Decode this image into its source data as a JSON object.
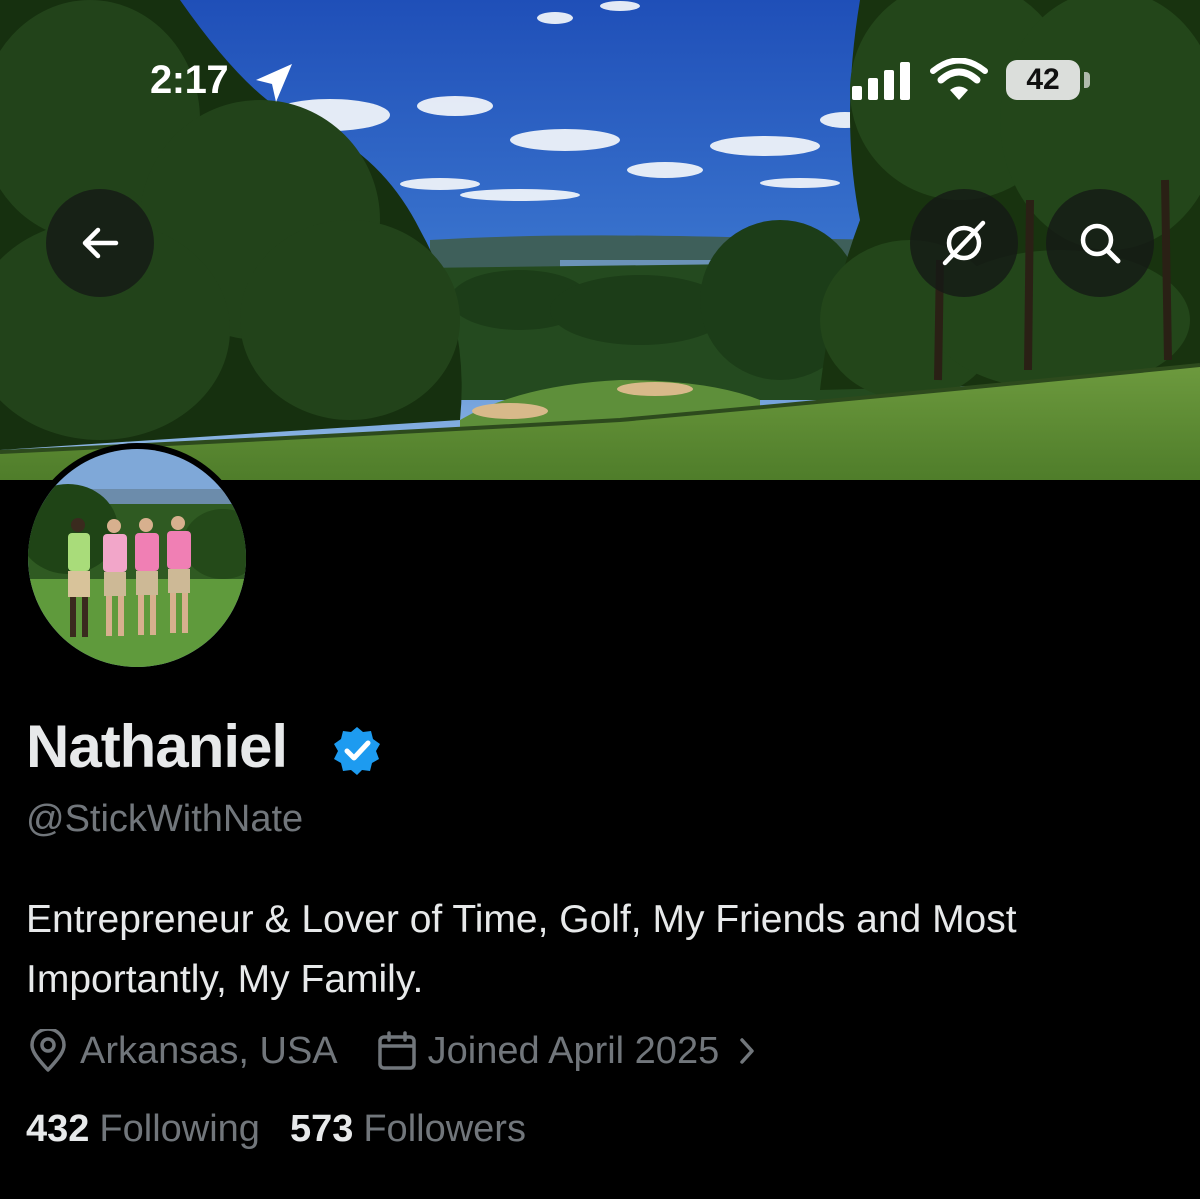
{
  "status_bar": {
    "time": "2:17",
    "battery": "42"
  },
  "header": {
    "back_icon": "arrow-left-icon",
    "grok_icon": "grok-slash-icon",
    "search_icon": "search-icon"
  },
  "profile": {
    "display_name": "Nathaniel",
    "handle": "@StickWithNate",
    "bio": "Entrepreneur & Lover of Time, Golf, My Friends and Most Importantly, My Family.",
    "location": "Arkansas, USA",
    "joined": "Joined April 2025",
    "following_count": "432",
    "following_label": "Following",
    "followers_count": "573",
    "followers_label": "Followers"
  },
  "colors": {
    "background": "#000000",
    "text_primary": "#e7e9ea",
    "text_secondary": "#71767b",
    "verified_blue": "#1d9bf0"
  }
}
